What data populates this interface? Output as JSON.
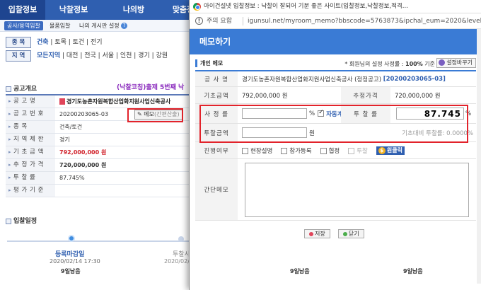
{
  "topnav": [
    "입찰정보",
    "낙찰정보",
    "나의방",
    "맞춤정"
  ],
  "subnav": {
    "selected": "공사/용역입찰",
    "items": [
      "물품입찰",
      "나의 게시판 설정"
    ]
  },
  "filters": {
    "category_label": "종 목",
    "category_values": [
      "건축",
      "토목",
      "토건",
      "전기"
    ],
    "region_label": "지 역",
    "region_values": [
      "모든지역",
      "대전",
      "전국",
      "서울",
      "인천",
      "경기",
      "강원"
    ]
  },
  "bg": {
    "section_title": "공고개요",
    "purple_note": "(낙찰코칭)출제 5번째 낙",
    "rows": [
      {
        "key": "공 고 명",
        "value": "경기도농촌자원복합산업화지원사업신축공사"
      },
      {
        "key": "공 고 번 호",
        "value": "20200203065-03"
      },
      {
        "key": "종 목",
        "value": "건축/토건"
      },
      {
        "key": "지 역 제 한",
        "value": "경기"
      },
      {
        "key": "기 초 금 액",
        "value": "792,000,000 원"
      },
      {
        "key": "추 정 가 격",
        "value": "720,000,000 원"
      },
      {
        "key": "투 찰 률",
        "value": "87.745%"
      },
      {
        "key": "평 가 기 준",
        "value": ""
      }
    ],
    "memo_button": {
      "label": "메모",
      "sub": "(간편산출)"
    },
    "schedule_title": "입찰일정",
    "timeline": [
      {
        "label": "등록마감일",
        "date": "2020/02/14 17:30",
        "dday": "9일남음"
      },
      {
        "label": "투찰시",
        "date": "2020/02/",
        "dday": ""
      }
    ],
    "timeline_extra": [
      "9일남음",
      "9일남음"
    ]
  },
  "popup": {
    "window_title": "아이건설넷 입찰정보 : 낙찰이 잘되어 기분 좋은 사이트(입찰정보,낙찰정보,적격...",
    "addr_warning": "주의 요함",
    "url": "igunsul.net/myroom_memo?bbscode=5763873&ipchal_eum=2020&level...",
    "header": "메모하기",
    "sub_title": "개인 메모",
    "setting_text_pre": "* 회원님의 설정 사정률 :",
    "setting_value": "100%",
    "setting_text_post": "기준",
    "setting_button": "설정바꾸기",
    "labels": {
      "project": "공 사 명",
      "base": "기초금액",
      "estimate": "추정가격",
      "rate": "사 정 률",
      "bid_rate": "투 찰 률",
      "bid_amount": "투찰금액",
      "progress": "진행여부",
      "memo": "간단메모"
    },
    "project_name": "경기도농촌자원복합산업화지원사업신축공사 (정정공고)",
    "project_no": "[20200203065-03]",
    "base_amount": "792,000,000 원",
    "estimate_amount": "720,000,000 원",
    "rate_value": "",
    "rate_unit": "%",
    "auto_calc": "자동계산",
    "bid_rate_value": "87.745",
    "bid_rate_unit": "%",
    "bid_amount_value": "",
    "bid_amount_unit": "원",
    "base_ratio": "기초대비 투찰률: 0.0000%",
    "progress_options": [
      {
        "label": "현장설명",
        "disabled": false
      },
      {
        "label": "참가등록",
        "disabled": false
      },
      {
        "label": "협정",
        "disabled": false
      },
      {
        "label": "투찰",
        "disabled": true
      }
    ],
    "one_click": "원클릭",
    "memo_text": "",
    "save_label": "저장",
    "close_label": "닫기"
  },
  "colors": {
    "accent": "#3a7bd5",
    "nav": "#2f5fb0",
    "highlight_box": "#e2232b",
    "price_red": "#d0202a"
  }
}
